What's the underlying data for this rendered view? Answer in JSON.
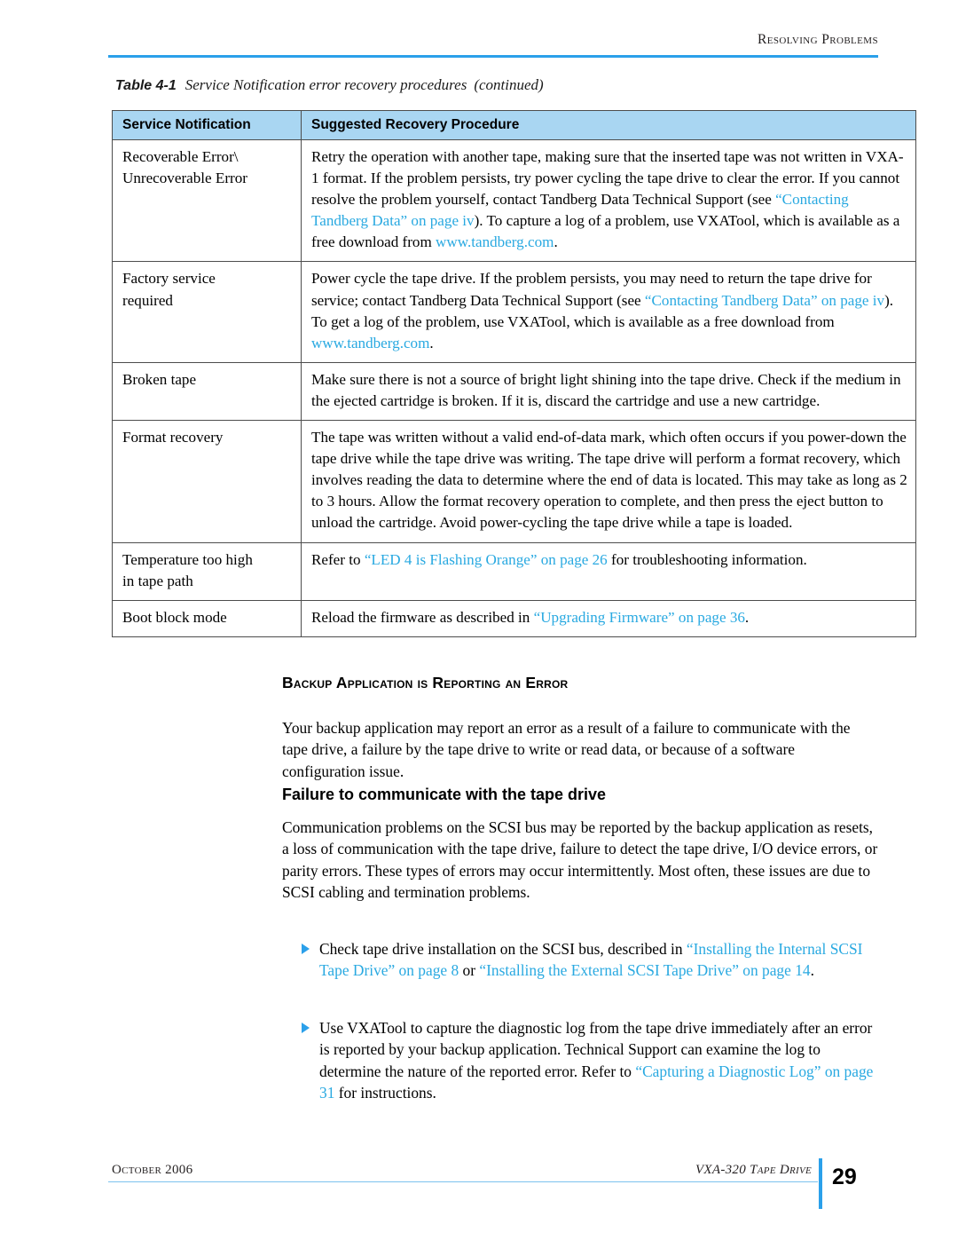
{
  "page": {
    "running_header": "Resolving Problems",
    "page_number": "29",
    "footer_left": "October 2006",
    "footer_right": "VXA-320 Tape Drive"
  },
  "table": {
    "caption_number": "Table 4-1",
    "caption_text": "Service Notification error recovery procedures",
    "caption_continued": "(continued)",
    "headers": [
      "Service Notification",
      "Suggested Recovery Procedure"
    ],
    "rows": [
      {
        "notification": "Recoverable Error\\ Unrecoverable Error",
        "notification_line1": "Recoverable Error\\",
        "notification_line2": "Unrecoverable Error",
        "procedure_parts": [
          {
            "text": "Retry the operation with another tape, making sure that the inserted tape was not written in VXA-1 format. If the problem persists, try power cycling the tape drive to clear the error. If you cannot resolve the problem yourself, contact Tandberg Data Technical Support (see ",
            "link": false
          },
          {
            "text": "“Contacting Tandberg Data” on page iv",
            "link": true
          },
          {
            "text": "). To capture a log of a problem, use VXATool, which is available as a free download from ",
            "link": false
          },
          {
            "text": "www.tandberg.com",
            "link": true
          },
          {
            "text": ".",
            "link": false
          }
        ]
      },
      {
        "notification": "Factory service required",
        "notification_line1": "Factory service",
        "notification_line2": "required",
        "procedure_parts": [
          {
            "text": "Power cycle the tape drive. If the problem persists, you may need to return the tape drive for service; contact Tandberg Data Technical Support (see ",
            "link": false
          },
          {
            "text": "“Contacting Tandberg Data” on page iv",
            "link": true
          },
          {
            "text": "). To get a log of the problem, use VXATool, which is available as a free download from ",
            "link": false
          },
          {
            "text": "www.tandberg.com",
            "link": true
          },
          {
            "text": ".",
            "link": false
          }
        ]
      },
      {
        "notification": "Broken tape",
        "notification_line1": "Broken tape",
        "notification_line2": "",
        "procedure_parts": [
          {
            "text": "Make sure there is not a source of bright light shining into the tape drive. Check if the medium in the ejected cartridge is broken. If it is, discard the cartridge and use a new cartridge.",
            "link": false
          }
        ]
      },
      {
        "notification": "Format recovery",
        "notification_line1": "Format recovery",
        "notification_line2": "",
        "procedure_parts": [
          {
            "text": "The tape was written without a valid end-of-data mark, which often occurs if you power-down the tape drive while the tape drive was writing. The tape drive will perform a format recovery, which involves reading the data to determine where the end of data is located. This may take as long as 2 to 3 hours. Allow the format recovery operation to complete, and then press the eject button to unload the cartridge. Avoid power-cycling the tape drive while a tape is loaded.",
            "link": false
          }
        ]
      },
      {
        "notification": "Temperature too high in tape path",
        "notification_line1": "Temperature too high",
        "notification_line2": "in tape path",
        "procedure_parts": [
          {
            "text": "Refer to ",
            "link": false
          },
          {
            "text": "“LED 4 is Flashing Orange” on page 26",
            "link": true
          },
          {
            "text": " for troubleshooting information.",
            "link": false
          }
        ]
      },
      {
        "notification": "Boot block mode",
        "notification_line1": "Boot block mode",
        "notification_line2": "",
        "procedure_parts": [
          {
            "text": "Reload the firmware as described in ",
            "link": false
          },
          {
            "text": "“Upgrading Firmware” on page 36",
            "link": true
          },
          {
            "text": ".",
            "link": false
          }
        ]
      }
    ]
  },
  "content": {
    "section_heading": "Backup Application is Reporting an Error",
    "intro_paragraph": "Your backup application may report an error as a result of a failure to communicate with the tape drive, a failure by the tape drive to write or read data, or because of a software configuration issue.",
    "sub_heading": "Failure to communicate with the tape drive",
    "comm_paragraph": "Communication problems on the SCSI bus may be reported by the backup application as resets, a loss of communication with the tape drive, failure to detect the tape drive, I/O device errors, or parity errors. These types of errors may occur intermittently. Most often, these issues are due to SCSI cabling and termination problems.",
    "bullets": [
      {
        "parts": [
          {
            "text": "Check tape drive installation on the SCSI bus, described in ",
            "link": false
          },
          {
            "text": "“Installing the Internal SCSI Tape Drive” on page 8",
            "link": true
          },
          {
            "text": " or ",
            "link": false
          },
          {
            "text": "“Installing the External SCSI Tape Drive” on page 14",
            "link": true
          },
          {
            "text": ".",
            "link": false
          }
        ]
      },
      {
        "parts": [
          {
            "text": "Use VXATool to capture the diagnostic log from the tape drive immediately after an error is reported by your backup application. Technical Support can examine the log to determine the nature of the reported error. Refer to ",
            "link": false
          },
          {
            "text": "“Capturing a Diagnostic Log” on page 31",
            "link": true
          },
          {
            "text": " for instructions.",
            "link": false
          }
        ]
      }
    ]
  },
  "colors": {
    "accent_blue": "#2ba0ea",
    "link_blue": "#29a9e1",
    "table_header_fill": "#a9d6f2"
  }
}
